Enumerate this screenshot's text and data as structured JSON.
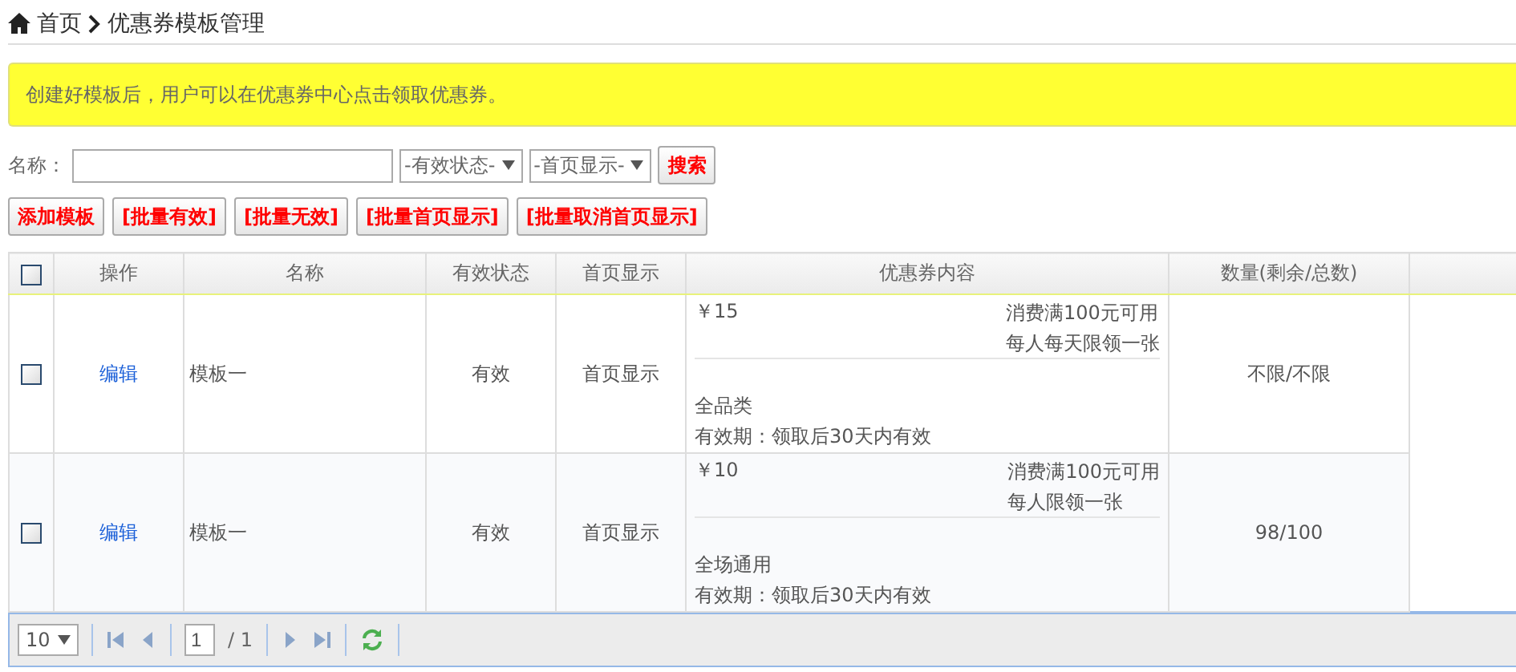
{
  "breadcrumb": {
    "home": "首页",
    "current": "优惠券模板管理"
  },
  "notice": "创建好模板后，用户可以在优惠券中心点击领取优惠券。",
  "search": {
    "name_label": "名称：",
    "status_select": "-有效状态-",
    "home_select": "-首页显示-",
    "search_button": "搜索"
  },
  "actions": [
    "添加模板",
    "[批量有效]",
    "[批量无效]",
    "[批量首页显示]",
    "[批量取消首页显示]"
  ],
  "table": {
    "select_all": {
      "checked": false
    },
    "columns": [
      "操作",
      "名称",
      "有效状态",
      "首页显示",
      "优惠券内容",
      "数量(剩余/总数)"
    ],
    "rows": [
      {
        "checked": false,
        "action": "编辑",
        "name": "模板一",
        "status": "有效",
        "home": "首页显示",
        "coupon": {
          "amount": "￥15",
          "condition": "消费满100元可用",
          "limit": "每人每天限领一张",
          "scope": "全品类",
          "validity": "有效期：领取后30天内有效"
        },
        "quantity": "不限/不限"
      },
      {
        "checked": false,
        "action": "编辑",
        "name": "模板一",
        "status": "有效",
        "home": "首页显示",
        "coupon": {
          "amount": "￥10",
          "condition": "消费满100元可用",
          "limit": "每人限领一张",
          "scope": "全场通用",
          "validity": "有效期：领取后30天内有效"
        },
        "quantity": "98/100"
      }
    ]
  },
  "pager": {
    "page_size": "10",
    "page": "1",
    "total": "/ 1"
  }
}
